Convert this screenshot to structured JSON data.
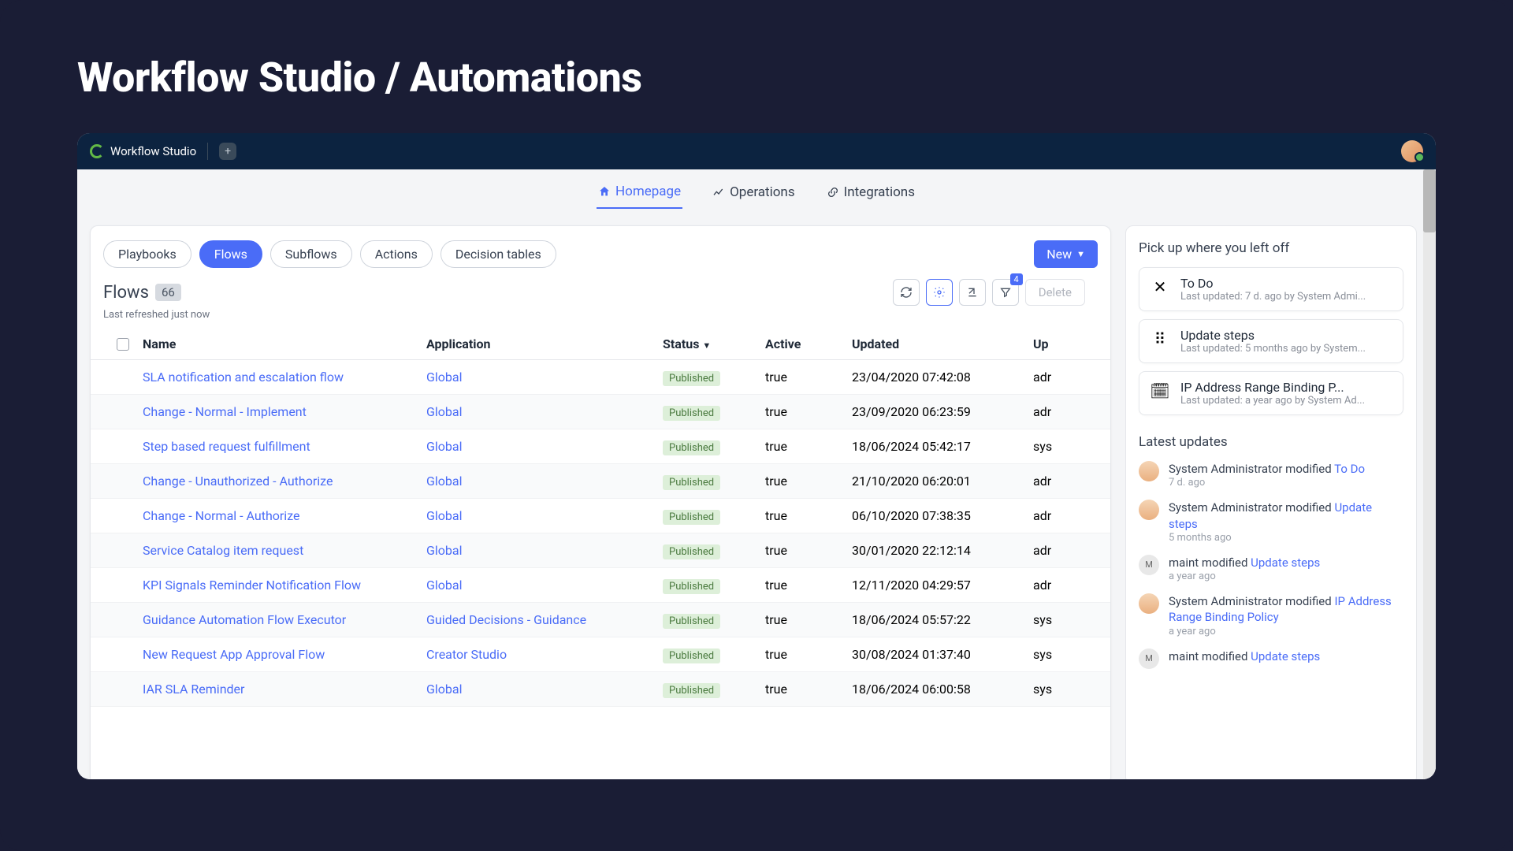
{
  "page_heading": "Workflow Studio / Automations",
  "app_name": "Workflow Studio",
  "top_tabs": {
    "homepage": "Homepage",
    "operations": "Operations",
    "integrations": "Integrations"
  },
  "pills": {
    "playbooks": "Playbooks",
    "flows": "Flows",
    "subflows": "Subflows",
    "actions": "Actions",
    "decision_tables": "Decision tables"
  },
  "new_button": "New",
  "section": {
    "title": "Flows",
    "count": "66",
    "refreshed": "Last refreshed just now"
  },
  "filter_badge": "4",
  "delete_label": "Delete",
  "columns": {
    "name": "Name",
    "application": "Application",
    "status": "Status",
    "active": "Active",
    "updated": "Updated",
    "updated_by": "Up"
  },
  "status_label": "Published",
  "rows": [
    {
      "name": "SLA notification and escalation flow",
      "app": "Global",
      "active": "true",
      "updated": "23/04/2020 07:42:08",
      "upby": "adr"
    },
    {
      "name": "Change - Normal - Implement",
      "app": "Global",
      "active": "true",
      "updated": "23/09/2020 06:23:59",
      "upby": "adr"
    },
    {
      "name": "Step based request fulfillment",
      "app": "Global",
      "active": "true",
      "updated": "18/06/2024 05:42:17",
      "upby": "sys"
    },
    {
      "name": "Change - Unauthorized - Authorize",
      "app": "Global",
      "active": "true",
      "updated": "21/10/2020 06:20:01",
      "upby": "adr"
    },
    {
      "name": "Change - Normal - Authorize",
      "app": "Global",
      "active": "true",
      "updated": "06/10/2020 07:38:35",
      "upby": "adr"
    },
    {
      "name": "Service Catalog item request",
      "app": "Global",
      "active": "true",
      "updated": "30/01/2020 22:12:14",
      "upby": "adr"
    },
    {
      "name": "KPI Signals Reminder Notification Flow",
      "app": "Global",
      "active": "true",
      "updated": "12/11/2020 04:29:57",
      "upby": "adr"
    },
    {
      "name": "Guidance Automation Flow Executor",
      "app": "Guided Decisions - Guidance",
      "active": "true",
      "updated": "18/06/2024 05:57:22",
      "upby": "sys"
    },
    {
      "name": "New Request App Approval Flow",
      "app": "Creator Studio",
      "active": "true",
      "updated": "30/08/2024 01:37:40",
      "upby": "sys"
    },
    {
      "name": "IAR SLA Reminder",
      "app": "Global",
      "active": "true",
      "updated": "18/06/2024 06:00:58",
      "upby": "sys"
    }
  ],
  "right": {
    "pickup_title": "Pick up where you left off",
    "recents": [
      {
        "title": "To Do",
        "sub": "Last updated: 7 d. ago by System Admi..."
      },
      {
        "title": "Update steps",
        "sub": "Last updated: 5 months ago by System..."
      },
      {
        "title": "IP Address Range Binding P...",
        "sub": "Last updated: a year ago by System Ad..."
      }
    ],
    "latest_title": "Latest updates",
    "updates": [
      {
        "who": "System Administrator",
        "verb": "modified",
        "link": "To Do",
        "time": "7 d. ago",
        "avatar": "face"
      },
      {
        "who": "System Administrator",
        "verb": "modified",
        "link": "Update steps",
        "time": "5 months ago",
        "avatar": "face"
      },
      {
        "who": "maint",
        "verb": "modified",
        "link": "Update steps",
        "time": "a year ago",
        "avatar": "M"
      },
      {
        "who": "System Administrator",
        "verb": "modified",
        "link": "IP Address Range Binding Policy",
        "time": "a year ago",
        "avatar": "face"
      },
      {
        "who": "maint",
        "verb": "modified",
        "link": "Update steps",
        "time": "",
        "avatar": "M"
      }
    ]
  }
}
